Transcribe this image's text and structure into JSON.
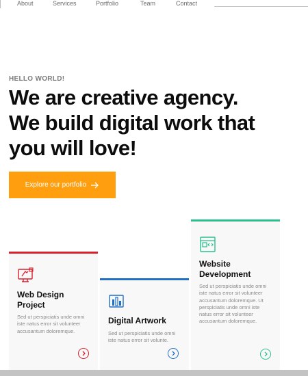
{
  "nav": {
    "items": [
      {
        "label": "About"
      },
      {
        "label": "Services"
      },
      {
        "label": "Portfolio"
      },
      {
        "label": "Team"
      },
      {
        "label": "Contact"
      }
    ]
  },
  "hero": {
    "eyebrow": "HELLO WORLD!",
    "headline_line1": "We are creative agency.",
    "headline_line2": "We build digital work that",
    "headline_line3": "you will love!",
    "cta_label": "Explore our portfolio"
  },
  "services": [
    {
      "title_line1": "Web Design",
      "title_line2": "Project",
      "text": "Sed ut perspiciatis unde omni iste natus error sit volunteer accusantum doloremque.",
      "accent": "#d9202c",
      "icon": "web-design-icon"
    },
    {
      "title_line1": "Digital Artwork",
      "title_line2": "",
      "text": "Sed ut perspiciatis unde omni iste natus error sit volunte.",
      "accent": "#1f6fc5",
      "icon": "digital-artwork-icon"
    },
    {
      "title_line1": "Website",
      "title_line2": "Development",
      "text": "Sed ut perspiciatis unde omni iste natus error sit volunteer accusantum doloremque. Ut perspiciatis unde omni iste natus error sit volunteer accusantum doloremque.",
      "accent": "#2bbf8e",
      "icon": "website-development-icon"
    }
  ],
  "colors": {
    "cta": "#ff9f0f",
    "text_dark": "#0c0c0c",
    "muted": "#8a8a8a"
  }
}
